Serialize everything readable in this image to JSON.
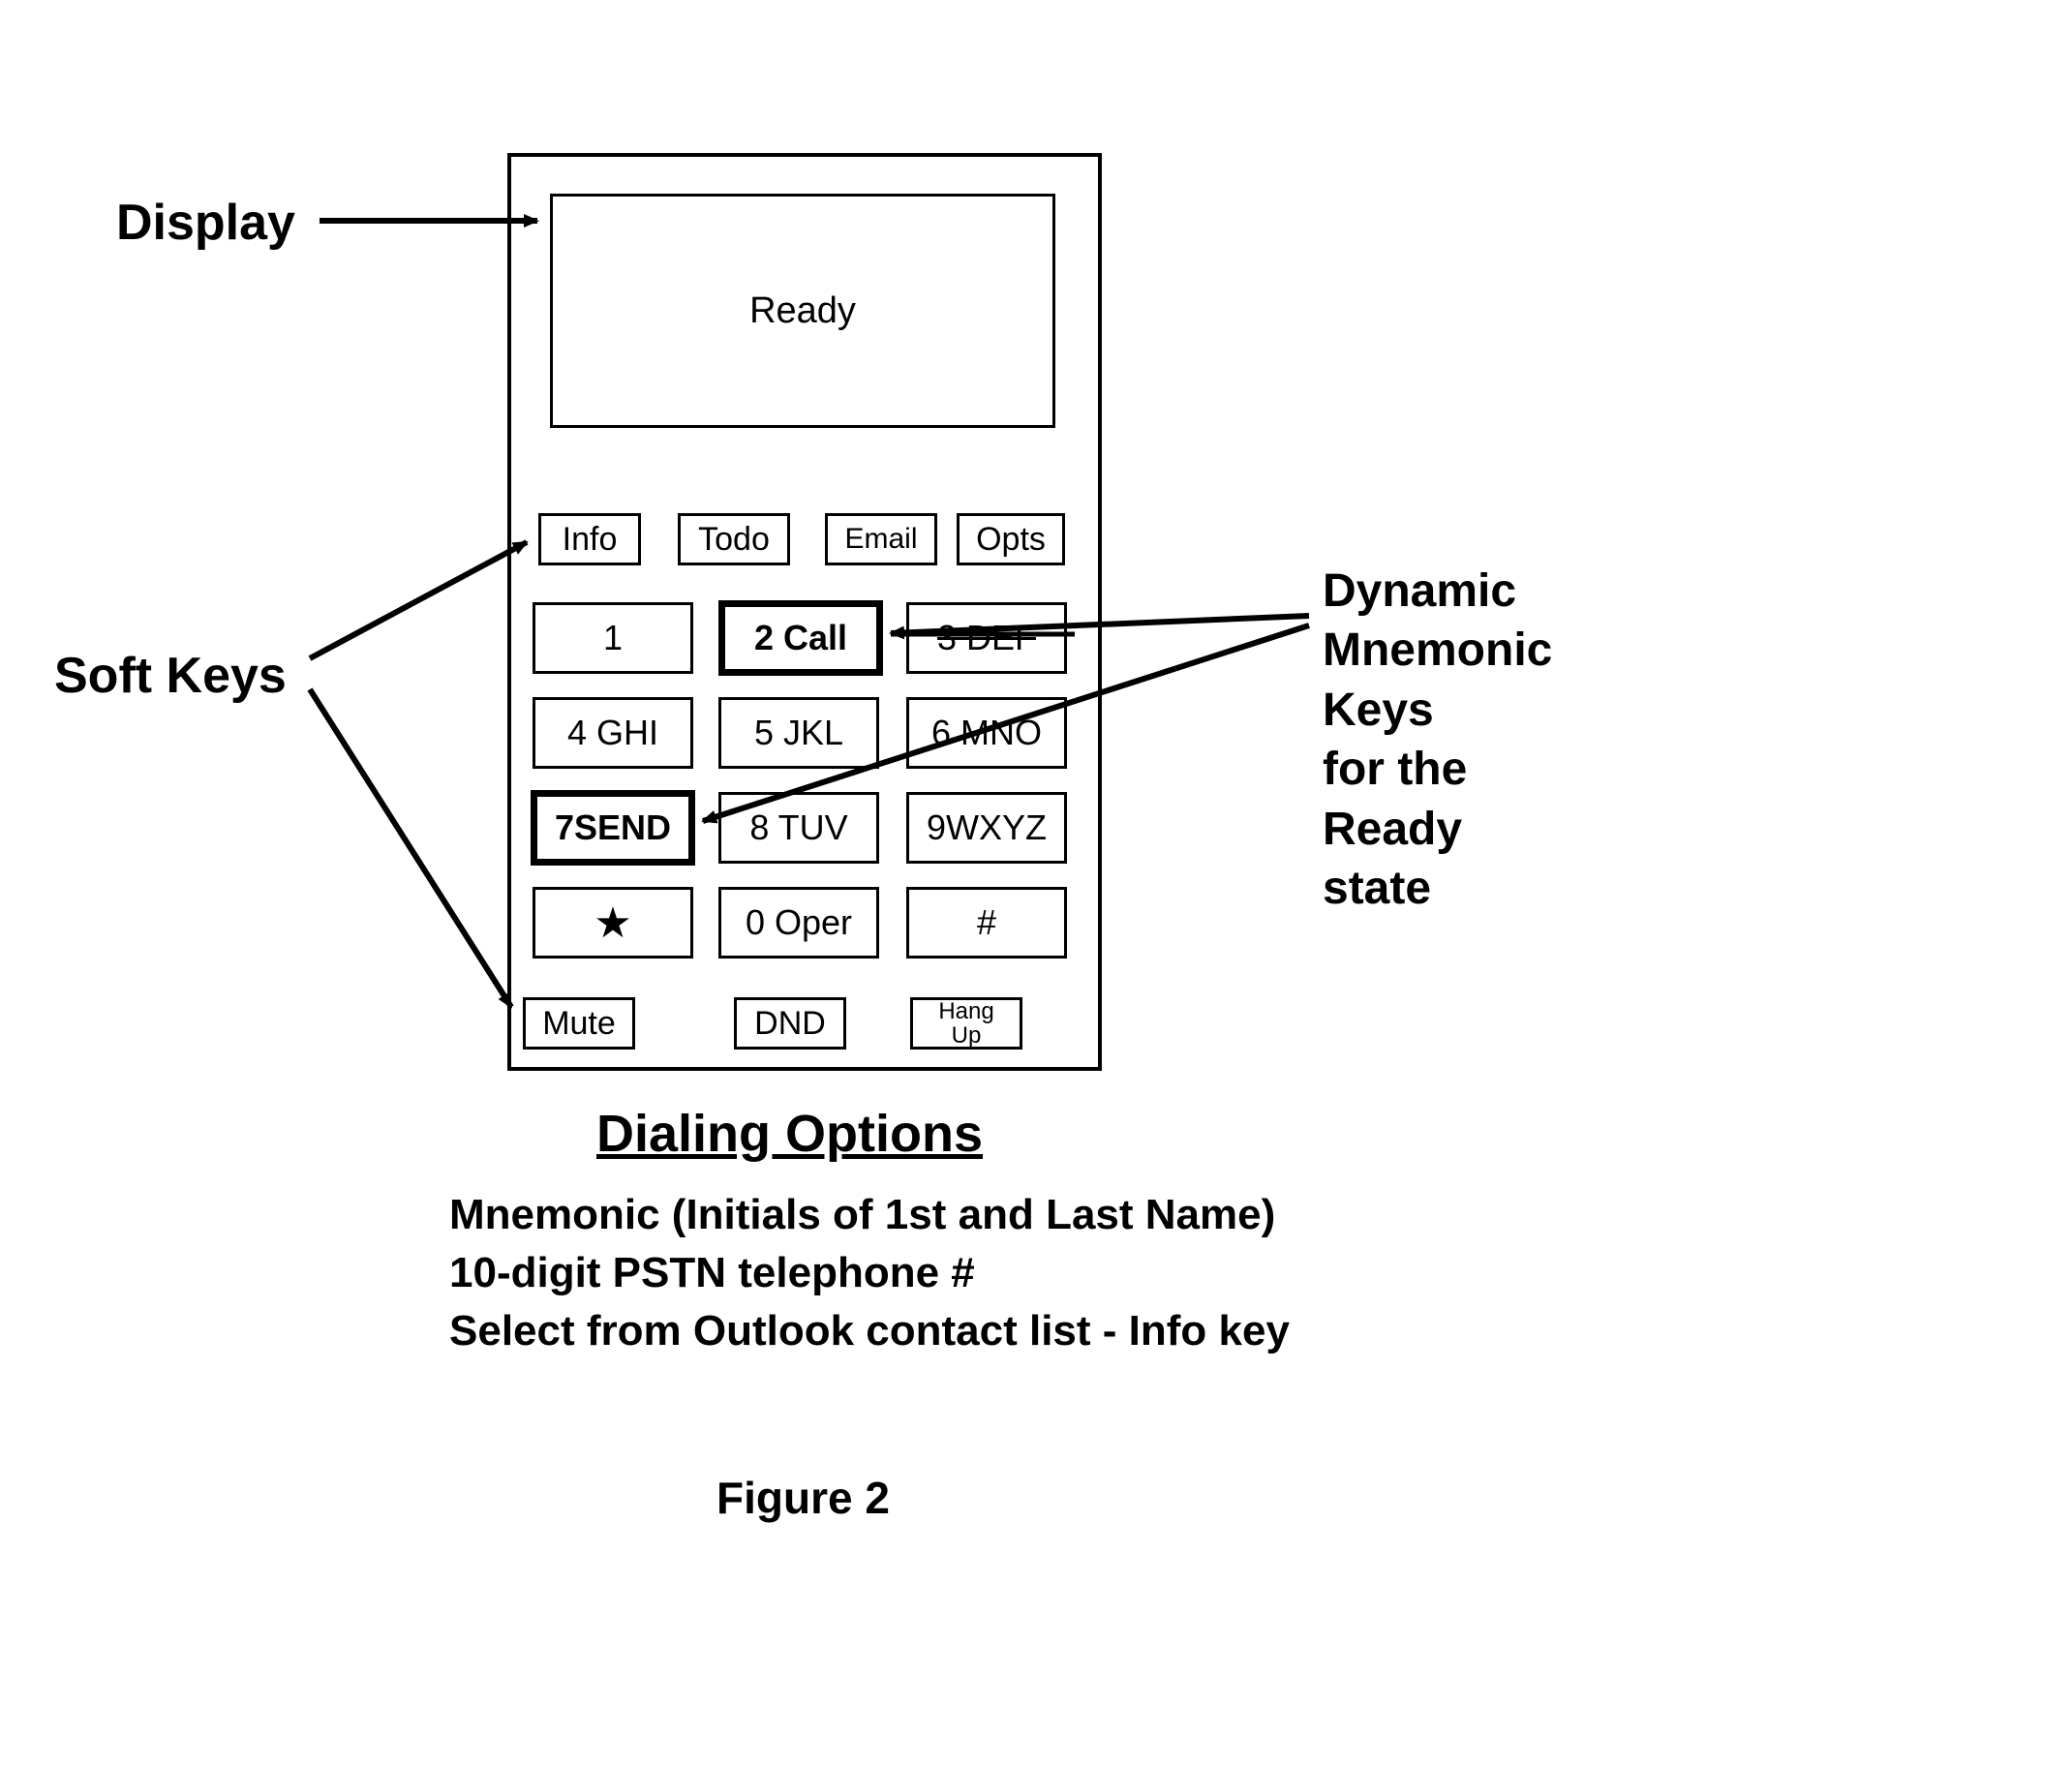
{
  "labels": {
    "display": "Display",
    "softkeys": "Soft Keys",
    "dynamic": "Dynamic\nMnemonic\nKeys\nfor the\nReady\nstate"
  },
  "phone": {
    "display_text": "Ready",
    "softkeys_top": [
      "Info",
      "Todo",
      "Email",
      "Opts"
    ],
    "keypad": {
      "r1": [
        {
          "label": "1",
          "bold": false,
          "strike": false
        },
        {
          "label": "2 Call",
          "bold": true,
          "strike": false
        },
        {
          "label": "3 DEF",
          "bold": false,
          "strike": true
        }
      ],
      "r2": [
        {
          "label": "4 GHI",
          "bold": false
        },
        {
          "label": "5 JKL",
          "bold": false
        },
        {
          "label": "6 MNO",
          "bold": false
        }
      ],
      "r3": [
        {
          "label": "7SEND",
          "bold": true
        },
        {
          "label": "8 TUV",
          "bold": false
        },
        {
          "label": "9WXYZ",
          "bold": false
        }
      ],
      "r4": [
        {
          "label": "★",
          "bold": false,
          "symbol": true
        },
        {
          "label": "0 Oper",
          "bold": false
        },
        {
          "label": "#",
          "bold": false
        }
      ]
    },
    "softkeys_bottom": [
      "Mute",
      "DND",
      "Hang\nUp"
    ]
  },
  "section": {
    "title": "Dialing Options",
    "lines": [
      "Mnemonic (Initials of 1st and Last Name)",
      "10-digit PSTN telephone #",
      "Select from Outlook contact list - Info key"
    ]
  },
  "caption": "Figure 2"
}
